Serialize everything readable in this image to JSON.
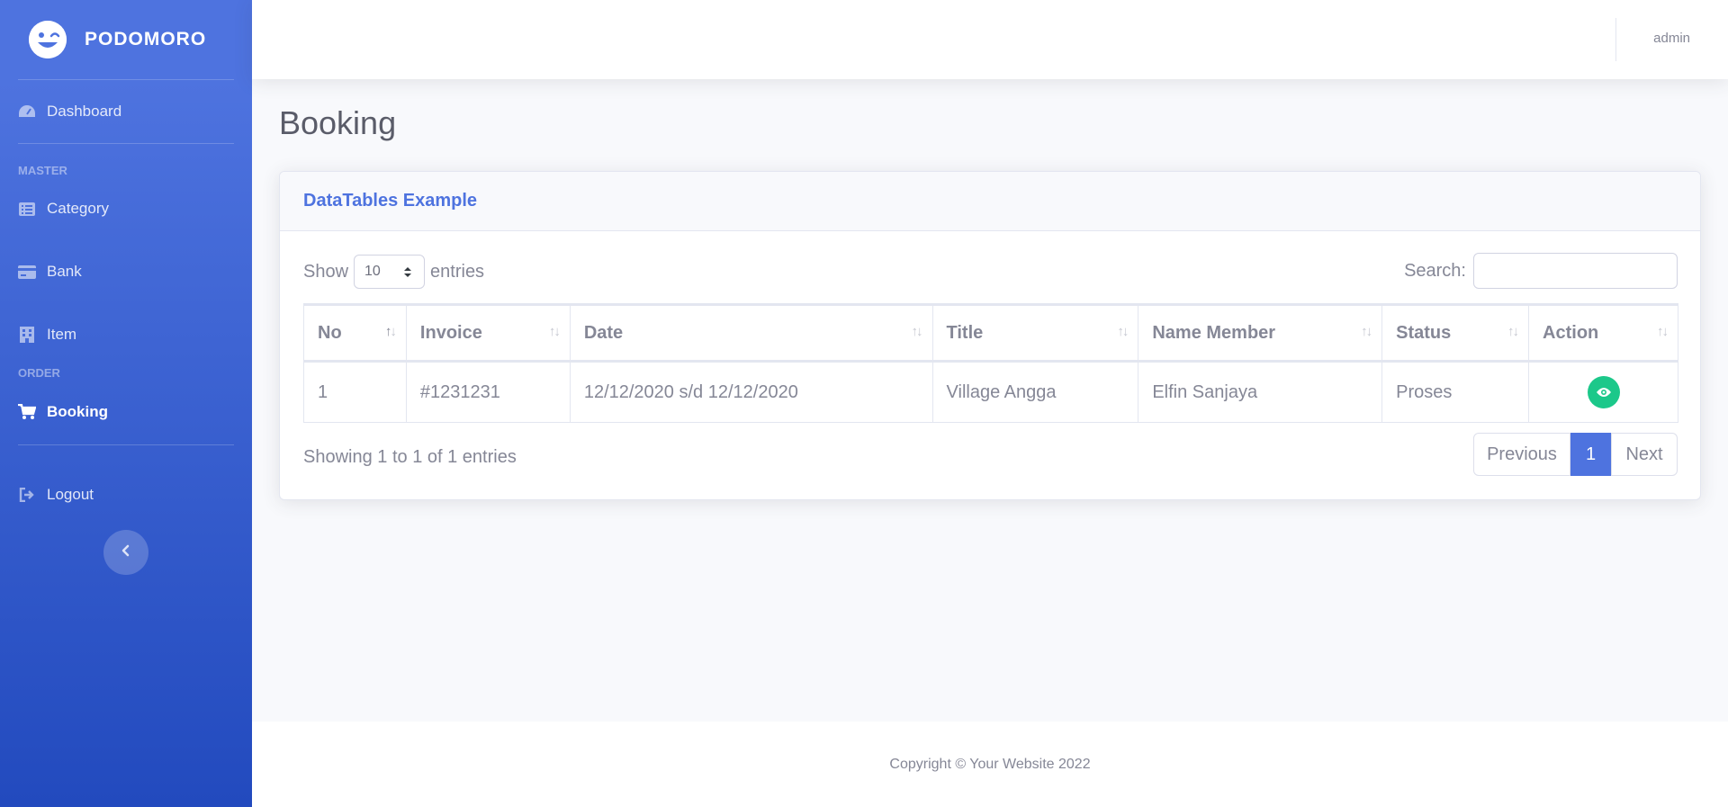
{
  "brand": {
    "name": "PODOMORO"
  },
  "sidebar": {
    "dashboard": "Dashboard",
    "heading_master": "MASTER",
    "category": "Category",
    "bank": "Bank",
    "item": "Item",
    "heading_order": "ORDER",
    "booking": "Booking",
    "logout": "Logout"
  },
  "topbar": {
    "username": "admin"
  },
  "page": {
    "title": "Booking"
  },
  "card": {
    "title": "DataTables Example",
    "show_label": "Show",
    "entries_value": "10",
    "entries_label": "entries",
    "search_label": "Search:",
    "search_value": "",
    "columns": [
      "No",
      "Invoice",
      "Date",
      "Title",
      "Name Member",
      "Status",
      "Action"
    ],
    "rows": [
      {
        "no": "1",
        "invoice": "#1231231",
        "date": "12/12/2020 s/d 12/12/2020",
        "title": "Village Angga",
        "member": "Elfin Sanjaya",
        "status": "Proses"
      }
    ],
    "info": "Showing 1 to 1 of 1 entries",
    "pagination": {
      "previous": "Previous",
      "current": "1",
      "next": "Next"
    }
  },
  "footer": {
    "copyright": "Copyright © Your Website 2022"
  },
  "colors": {
    "primary": "#4e73df",
    "success": "#1cc88a",
    "sidebar_bottom": "#224abe"
  },
  "icons": [
    "laugh-wink-icon",
    "tachometer-icon",
    "list-icon",
    "credit-card-icon",
    "building-icon",
    "cart-icon",
    "logout-icon",
    "chevron-left-icon",
    "eye-icon",
    "sort-icon"
  ]
}
